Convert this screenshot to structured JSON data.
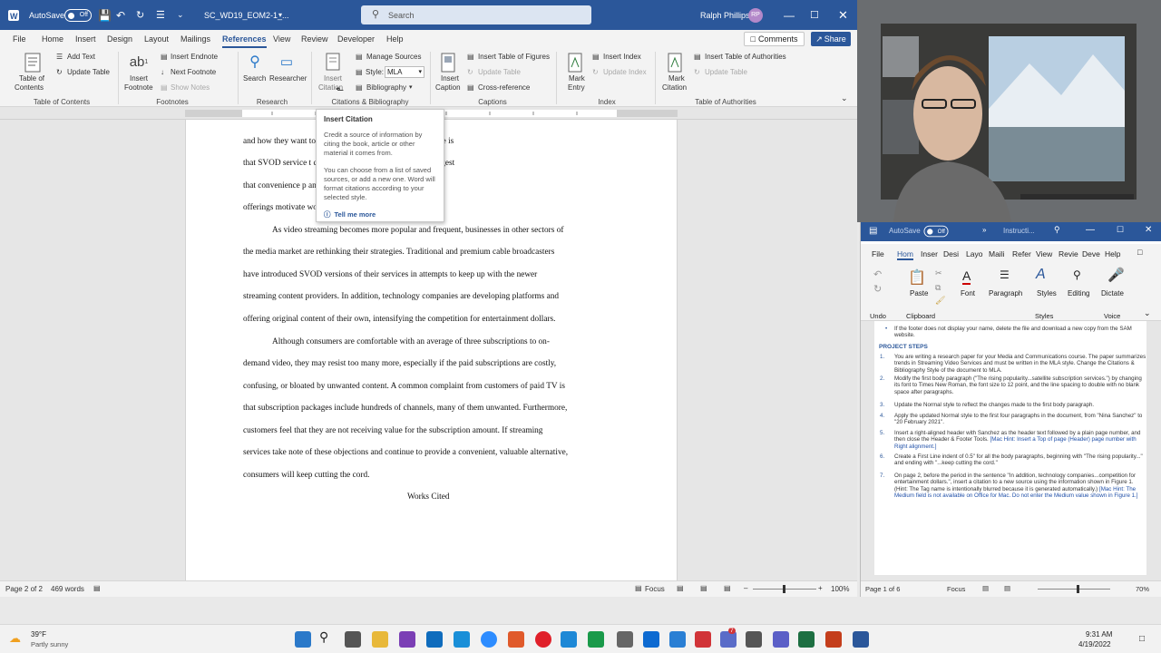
{
  "word": {
    "title": {
      "autosave_label": "AutoSave",
      "autosave_state": "Off",
      "filename": "SC_WD19_EOM2-1_...",
      "search_placeholder": "Search",
      "user_name": "Ralph Phillips",
      "user_initials": "RP"
    },
    "menu": [
      "File",
      "Home",
      "Insert",
      "Design",
      "Layout",
      "Mailings",
      "References",
      "View",
      "Review",
      "Developer",
      "Help"
    ],
    "menu_active": "References",
    "comments_label": "Comments",
    "share_label": "Share",
    "ribbon": {
      "toc": {
        "button": "Table of",
        "button2": "Contents",
        "add_text": "Add Text",
        "update_table": "Update Table",
        "group": "Table of Contents"
      },
      "footnotes": {
        "insert_footnote": "Insert",
        "insert_footnote2": "Footnote",
        "insert_endnote": "Insert Endnote",
        "next_footnote": "Next Footnote",
        "show_notes": "Show Notes",
        "group": "Footnotes"
      },
      "research": {
        "search": "Search",
        "researcher": "Researcher",
        "group": "Research"
      },
      "citations": {
        "insert_citation": "Insert",
        "insert_citation2": "Citation",
        "manage_sources": "Manage Sources",
        "style_label": "Style:",
        "style_value": "MLA",
        "bibliography": "Bibliography",
        "group": "Citations & Bibliography"
      },
      "captions": {
        "insert_caption": "Insert",
        "insert_caption2": "Caption",
        "insert_table_of_figures": "Insert Table of Figures",
        "update_table": "Update Table",
        "cross_reference": "Cross-reference",
        "group": "Captions"
      },
      "index": {
        "mark_entry": "Mark",
        "mark_entry2": "Entry",
        "insert_index": "Insert Index",
        "update_index": "Update Index",
        "group": "Index"
      },
      "authorities": {
        "mark_citation": "Mark",
        "mark_citation2": "Citation",
        "insert_toa": "Insert Table of Authorities",
        "update_table": "Update Table",
        "group": "Table of Authorities"
      }
    },
    "tooltip": {
      "title": "Insert Citation",
      "p1": "Credit a source of information by citing the book, article or other material it comes from.",
      "p2": "You can choose from a list of saved sources, or add a new one. Word will format citations according to your selected style.",
      "link": "Tell me more"
    },
    "document_lines": [
      "and how they want                                        top, or smart TV. Another key advantage is",
      "that SVOD service                                        t consumers find valuable. Surveys suggest",
      "that convenience p                                       and the quality and originality of the",
      "offerings motivate                                       wood).",
      "As video streaming becomes more popular and frequent, businesses in other sectors of",
      "the media market are rethinking their strategies. Traditional and premium cable broadcasters",
      "have introduced SVOD versions of their services in attempts to keep up with the newer",
      "streaming content providers. In addition, technology companies are developing platforms and",
      "offering original content of their own, intensifying the competition for entertainment dollars.",
      "Although consumers are comfortable with an average of three subscriptions to on-",
      "demand video, they may resist too many more, especially if the paid subscriptions are costly,",
      "confusing, or bloated by unwanted content. A common complaint from customers of paid TV is",
      "that subscription packages include hundreds of channels, many of them unwanted. Furthermore,",
      "customers feel that they are not receiving value for the subscription amount. If streaming",
      "services take note of these objections and continue to provide a convenient, valuable alternative,",
      "consumers will keep cutting the cord."
    ],
    "works_cited": "Works Cited",
    "status": {
      "page": "Page 2 of 2",
      "words": "469 words",
      "focus": "Focus",
      "zoom": "100%"
    }
  },
  "side": {
    "autosave_label": "AutoSave",
    "autosave_state": "Off",
    "filename": "Instructi...",
    "menu": [
      "File",
      "Hom",
      "Inser",
      "Desi",
      "Layo",
      "Maili",
      "Refer",
      "View",
      "Revie",
      "Deve",
      "Help"
    ],
    "ribbon": {
      "undo": "Undo",
      "paste": "Paste",
      "clipboard": "Clipboard",
      "font": "Font",
      "paragraph": "Paragraph",
      "styles": "Styles",
      "styles_group": "Styles",
      "editing": "Editing",
      "dictate": "Dictate",
      "voice": "Voice"
    },
    "doc": {
      "bullet": "If the footer does not display your name, delete the file and download a new copy from the SAM website.",
      "heading": "PROJECT STEPS",
      "steps": [
        {
          "n": "1.",
          "text": "You are writing a research paper for your Media and Communications course. The paper summarizes trends in Streaming Video Services and must be written in the MLA style. Change the Citations & Bibliography Style of the document to MLA.",
          "hint": ""
        },
        {
          "n": "2.",
          "text": "Modify the first body paragraph (\"The rising popularity...satellite subscription services.\") by changing its font to Times New Roman, the font size to 12 point, and the line spacing to double with no blank space after paragraphs.",
          "hint": ""
        },
        {
          "n": "3.",
          "text": "Update the Normal style to reflect the changes made to the first body paragraph.",
          "hint": ""
        },
        {
          "n": "4.",
          "text": "Apply the updated Normal style to the first four paragraphs in the document, from \"Nina Sanchez\" to \"20 February 2021\".",
          "hint": ""
        },
        {
          "n": "5.",
          "text": "Insert a right-aligned header with Sanchez as the header text followed by a plain page number, and then close the Header & Footer Tools.",
          "hint": "[Mac Hint: Insert a Top of page (Header) page number with Right alignment.]"
        },
        {
          "n": "6.",
          "text": "Create a First Line indent of 0.5\" for all the body paragraphs, beginning with \"The rising popularity...\" and ending with \"...keep cutting the cord.\"",
          "hint": ""
        },
        {
          "n": "7.",
          "text": "On page 2, before the period in the sentence \"In addition, technology companies...competition for entertainment dollars.\", insert a citation to a new source using the information shown in Figure 1. (Hint: The Tag name is intentionally blurred because it is generated automatically.)",
          "hint": "[Mac Hint: The Medium field is not available on Office for Mac. Do not enter the Medium value shown in Figure 1.]"
        }
      ]
    },
    "status": {
      "page": "Page 1 of 6",
      "focus": "Focus",
      "zoom": "70%"
    }
  },
  "taskbar": {
    "temp": "39°F",
    "weather": "Partly sunny",
    "time": "9:31 AM",
    "date": "4/19/2022",
    "badge": "7"
  },
  "colors": {
    "word_blue": "#2b579a",
    "highlight": "#ffeb00"
  }
}
